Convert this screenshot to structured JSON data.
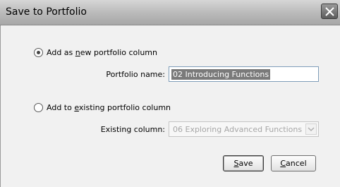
{
  "dialog": {
    "title": "Save to Portfolio"
  },
  "options": {
    "new_column": {
      "pre": "Add as ",
      "key": "n",
      "post": "ew portfolio column",
      "selected": true
    },
    "existing_column": {
      "pre": "Add to ",
      "key": "e",
      "post": "xisting portfolio column",
      "selected": false
    }
  },
  "fields": {
    "portfolio_name_label": "Portfolio name:",
    "portfolio_name_value": "02 Introducing Functions",
    "existing_column_label": "Existing column:",
    "existing_column_value": "06 Exploring Advanced Functions"
  },
  "buttons": {
    "save_key": "S",
    "save_rest": "ave",
    "cancel_key": "C",
    "cancel_rest": "ancel"
  },
  "icons": {
    "close": "close-icon",
    "dropdown": "chevron-down-icon"
  }
}
